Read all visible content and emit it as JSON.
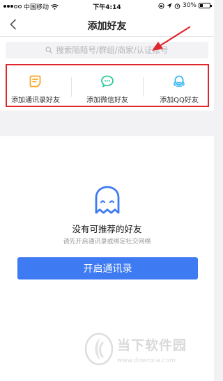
{
  "status_bar": {
    "carrier": "中国移动",
    "time": "下午4:14",
    "battery": "30%",
    "battery_level": 0.3
  },
  "nav": {
    "title": "添加好友",
    "back_icon": "chevron-left-icon"
  },
  "search": {
    "placeholder": "搜索陌陌号/群组/商家/认证账号",
    "icon": "search-icon"
  },
  "actions": [
    {
      "label": "添加通讯录好友",
      "icon": "contacts-book-icon",
      "color": "#f5a623"
    },
    {
      "label": "添加微信好友",
      "icon": "wechat-icon",
      "color": "#2ec99c"
    },
    {
      "label": "添加QQ好友",
      "icon": "qq-penguin-icon",
      "color": "#3db8f5"
    }
  ],
  "empty_state": {
    "icon": "ghost-icon",
    "title": "没有可推荐的好友",
    "subtitle": "请先开启通讯录或绑定社交网络",
    "button_label": "开启通讯录"
  },
  "watermark": {
    "name": "当下软件园",
    "url": "www.downxia.com"
  },
  "colors": {
    "accent": "#3e7bf2",
    "annotation_red": "#e0262d"
  }
}
